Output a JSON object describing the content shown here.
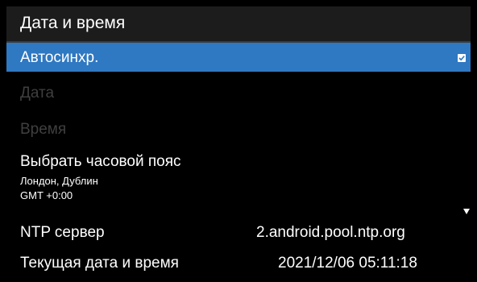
{
  "header": {
    "title": "Дата и время"
  },
  "settings": {
    "autosync": {
      "label": "Автосинхр.",
      "checked": true
    },
    "date": {
      "label": "Дата",
      "enabled": false
    },
    "time": {
      "label": "Время",
      "enabled": false
    },
    "timezone": {
      "label": "Выбрать часовой пояс",
      "city": "Лондон, Дублин",
      "offset": "GMT +0:00"
    },
    "ntp": {
      "label": "NTP сервер",
      "value": "2.android.pool.ntp.org"
    },
    "current": {
      "label": "Текущая дата и время",
      "value": "2021/12/06 05:11:18"
    }
  },
  "colors": {
    "highlight": "#2f78c2",
    "header_bg": "#1c1c1c",
    "disabled_text": "#3f3f3f"
  },
  "icons": {
    "autosync_check": "checkbox-checked-icon",
    "scroll": "scroll-down-arrow-icon"
  }
}
